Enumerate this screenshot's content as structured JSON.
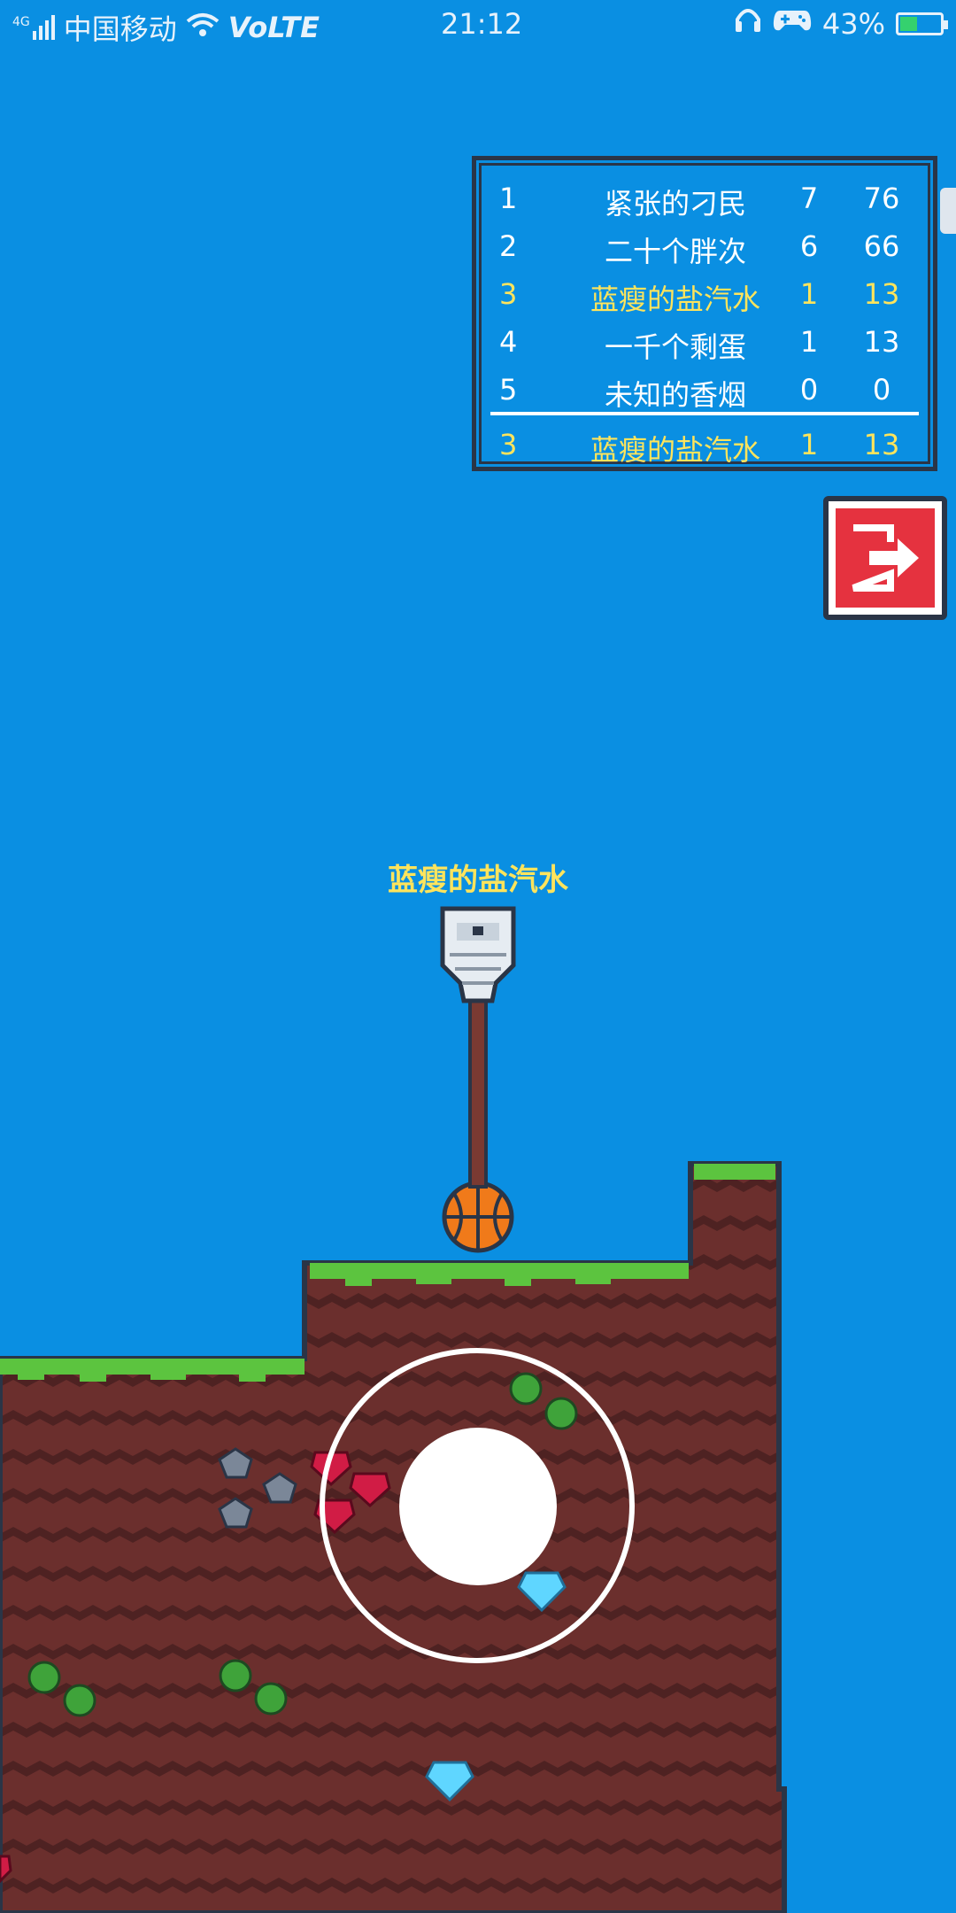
{
  "status_bar": {
    "network": "4G",
    "carrier": "中国移动",
    "volte": "VoLTE",
    "time": "21:12",
    "battery": "43%",
    "battery_level": 0.43,
    "icons": [
      "signal-icon",
      "wifi-icon",
      "headphones-icon",
      "gamepad-icon",
      "battery-icon"
    ]
  },
  "leaderboard": {
    "rows": [
      {
        "rank": "1",
        "name": "紧张的刁民",
        "kills": "7",
        "score": "76"
      },
      {
        "rank": "2",
        "name": "二十个胖次",
        "kills": "6",
        "score": "66"
      },
      {
        "rank": "3",
        "name": "蓝瘦的盐汽水",
        "kills": "1",
        "score": "13",
        "self": true
      },
      {
        "rank": "4",
        "name": "一千个剩蛋",
        "kills": "1",
        "score": "13"
      },
      {
        "rank": "5",
        "name": "未知的香烟",
        "kills": "0",
        "score": "0"
      }
    ],
    "self_row": {
      "rank": "3",
      "name": "蓝瘦的盐汽水",
      "kills": "1",
      "score": "13"
    },
    "highlight_color": "#ffe45c"
  },
  "exit_button": {
    "icon": "exit-icon",
    "color": "#e5323f"
  },
  "player": {
    "name": "蓝瘦的盐汽水"
  },
  "colors": {
    "sky": "#0a8fe2",
    "dirt": "#6b2f2d",
    "dirt_dark": "#4e2222",
    "grass": "#5cc43f",
    "outline": "#2a3547"
  }
}
